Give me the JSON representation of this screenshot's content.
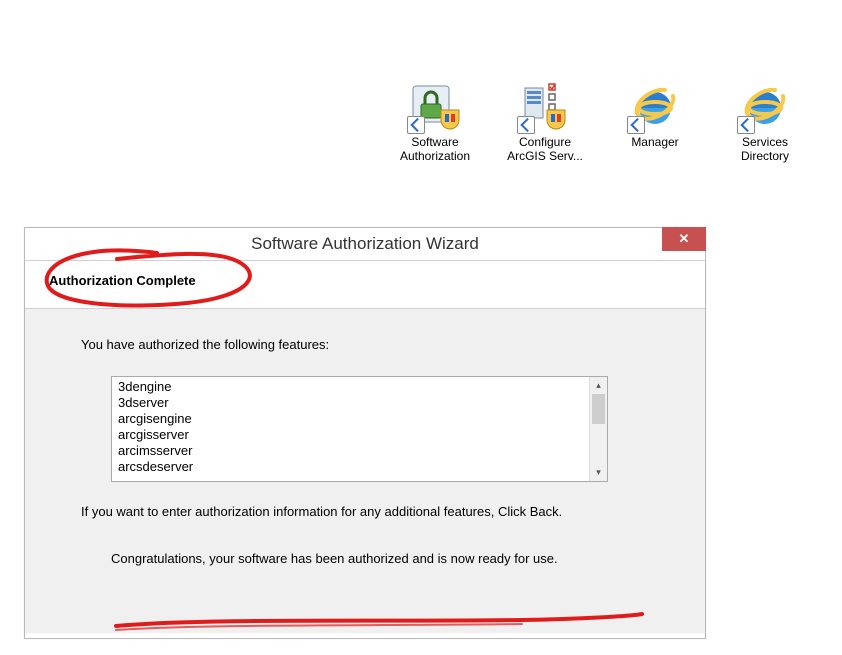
{
  "desktop": {
    "icons": [
      {
        "label": "Software Authorization",
        "icon": "lock-shield-icon"
      },
      {
        "label": "Configure ArcGIS Serv...",
        "icon": "server-shield-icon"
      },
      {
        "label": "Manager",
        "icon": "ie-icon"
      },
      {
        "label": "Services Directory",
        "icon": "ie-icon"
      }
    ]
  },
  "dialog": {
    "title": "Software Authorization Wizard",
    "close_label": "✕",
    "heading": "Authorization Complete",
    "intro": "You have authorized the following features:",
    "features": [
      "3dengine",
      "3dserver",
      "arcgisengine",
      "arcgisserver",
      "arcimsserver",
      "arcsdeserver"
    ],
    "note": "If you want to enter authorization information for any additional features, Click Back.",
    "congrats": "Congratulations, your software has been authorized and is now ready for use."
  }
}
